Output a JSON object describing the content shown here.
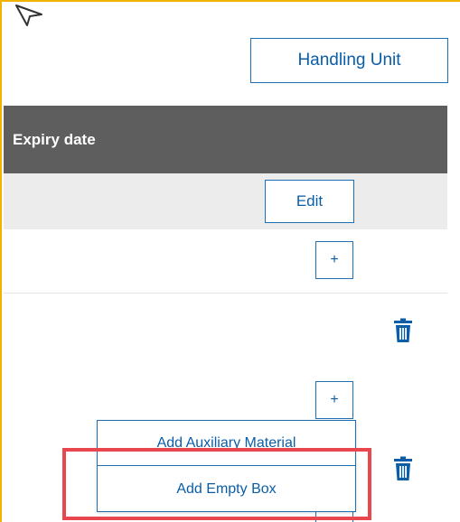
{
  "toolbar": {
    "handling_unit_label": "Handling Unit"
  },
  "table": {
    "columns": [
      "Expiry date"
    ]
  },
  "rows": [
    {
      "action_label": "Edit"
    },
    {
      "action_label": "+"
    }
  ],
  "items": [
    {
      "add_label": "+",
      "delete_icon": "trash-icon"
    },
    {
      "add_label": "+",
      "delete_icon": "trash-icon"
    }
  ],
  "menu": {
    "items": [
      {
        "label": "Add Auxiliary Material"
      },
      {
        "label": "Add Empty Box"
      }
    ]
  },
  "colors": {
    "accent": "#0a5ea8",
    "header_bg": "#5e5e5e",
    "row_bg": "#ececec",
    "highlight": "#e8474f",
    "frame": "#f0b400"
  }
}
